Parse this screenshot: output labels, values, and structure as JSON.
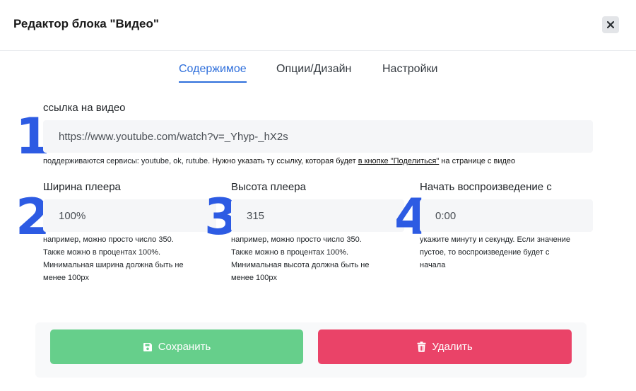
{
  "modal": {
    "title": "Редактор блока \"Видео\""
  },
  "tabs": [
    {
      "label": "Содержимое",
      "active": true
    },
    {
      "label": "Опции/Дизайн",
      "active": false
    },
    {
      "label": "Настройки",
      "active": false
    }
  ],
  "fields": {
    "url": {
      "number": "1",
      "label": "ссылка на видео",
      "value": "https://www.youtube.com/watch?v=_Yhyp-_hX2s",
      "help_prefix": "поддерживаются сервисы: youtube, ok, rutube.",
      "help_bold": " Нужно указать ту ссылку, которая будет ",
      "help_link": "в кнопке \"Поделиться\"",
      "help_suffix": " на странице с видео"
    },
    "width": {
      "number": "2",
      "label": "Ширина плеера",
      "value": "100%",
      "help": [
        "например, можно просто число 350.",
        "Также можно в процентах 100%.",
        "Минимальная ширина должна быть не",
        "менее 100px"
      ]
    },
    "height": {
      "number": "3",
      "label": "Высота плеера",
      "value": "315",
      "help": [
        "например, можно просто число 350.",
        "Также можно в процентах 100%.",
        "Минимальная высота должна быть не",
        "менее 100px"
      ]
    },
    "start": {
      "number": "4",
      "label": "Начать воспроизведение с",
      "value": "0:00",
      "help": [
        "укажите минуту и секунду. Если значение",
        "пустое, то воспроизведение будет с",
        "начала"
      ]
    }
  },
  "buttons": {
    "save_label": "Сохранить",
    "delete_label": "Удалить"
  },
  "icons": {
    "close": "close-icon",
    "save": "floppy-disk-icon",
    "delete": "trash-icon"
  },
  "colors": {
    "accent": "#2f6fdb",
    "number": "#2d5be3",
    "save": "#66cf8b",
    "delete": "#ea4368"
  }
}
